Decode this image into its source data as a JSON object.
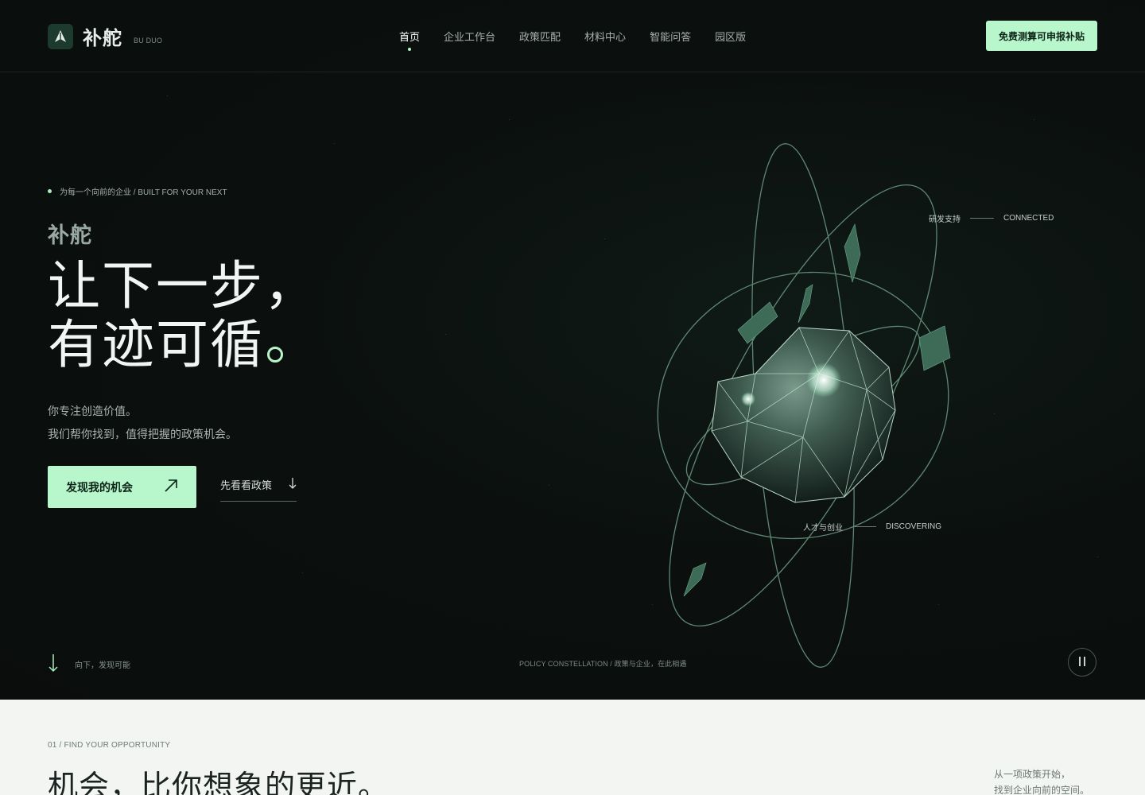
{
  "header": {
    "logo_name": "补舵",
    "logo_sub": "BU DUO",
    "nav": [
      {
        "label": "首页",
        "active": true
      },
      {
        "label": "企业工作台",
        "active": false
      },
      {
        "label": "政策匹配",
        "active": false
      },
      {
        "label": "材料中心",
        "active": false
      },
      {
        "label": "智能问答",
        "active": false
      },
      {
        "label": "园区版",
        "active": false
      }
    ],
    "cta_label": "免费测算可申报补贴"
  },
  "hero": {
    "eyebrow": "为每一个向前的企业 / BUILT FOR YOUR NEXT",
    "brand": "补舵",
    "headline_line1": "让下一步，",
    "headline_line2": "有迹可循",
    "intro_line1": "你专注创造价值。",
    "intro_line2": "我们帮你找到，值得把握的政策机会。",
    "primary_button": "发现我的机会",
    "secondary_button": "先看看政策",
    "scroll_hint": "向下，发现可能",
    "caption": "POLICY CONSTELLATION / 政策与企业，在此相遇",
    "tag_top": {
      "cn": "研发支持",
      "en": "CONNECTED"
    },
    "tag_bottom": {
      "cn": "人才与创业",
      "en": "DISCOVERING"
    }
  },
  "section2": {
    "eyebrow": "01 / FIND YOUR OPPORTUNITY",
    "title": "机会，比你想象的更近。",
    "side_line1": "从一项政策开始，",
    "side_line2": "找到企业向前的空间。"
  },
  "colors": {
    "accent": "#b8f6cb",
    "background": "#0b0f0e",
    "light_section": "#f3f5f2"
  },
  "icons": {
    "logo": "sail-logo-icon",
    "primary_arrow": "arrow-up-right-icon",
    "secondary_arrow": "arrow-down-icon",
    "scroll_arrow": "arrow-down-icon",
    "pause": "pause-icon"
  }
}
